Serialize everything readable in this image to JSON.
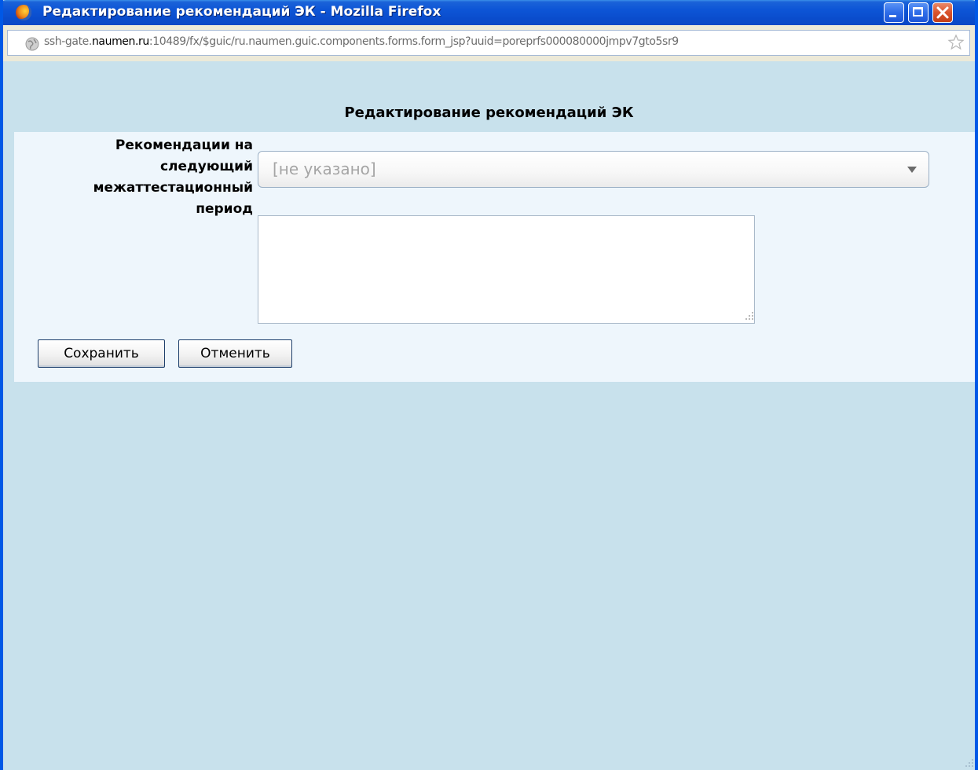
{
  "window": {
    "title": "Редактирование рекомендаций ЭК - Mozilla Firefox",
    "controls": [
      "minimize-icon",
      "maximize-icon",
      "close-icon"
    ]
  },
  "urlbar": {
    "url_prefix": "ssh-gate.",
    "url_host": "naumen.ru",
    "url_rest": ":10489/fx/$guic/ru.naumen.guic.components.forms.form_jsp?uuid=poreprfs000080000jmpv7gto5sr9",
    "icons": [
      "globe-icon",
      "star-icon"
    ]
  },
  "page": {
    "title": "Редактирование рекомендаций ЭК"
  },
  "form": {
    "field_label": "Рекомендации на следующий межаттестационный период",
    "select_value": "[не указано]",
    "textarea_value": "",
    "save_label": "Сохранить",
    "cancel_label": "Отменить"
  },
  "colors": {
    "titlebar": "#0a4ccc",
    "page_background": "#c8e1ec",
    "form_background": "#eef6fc"
  }
}
